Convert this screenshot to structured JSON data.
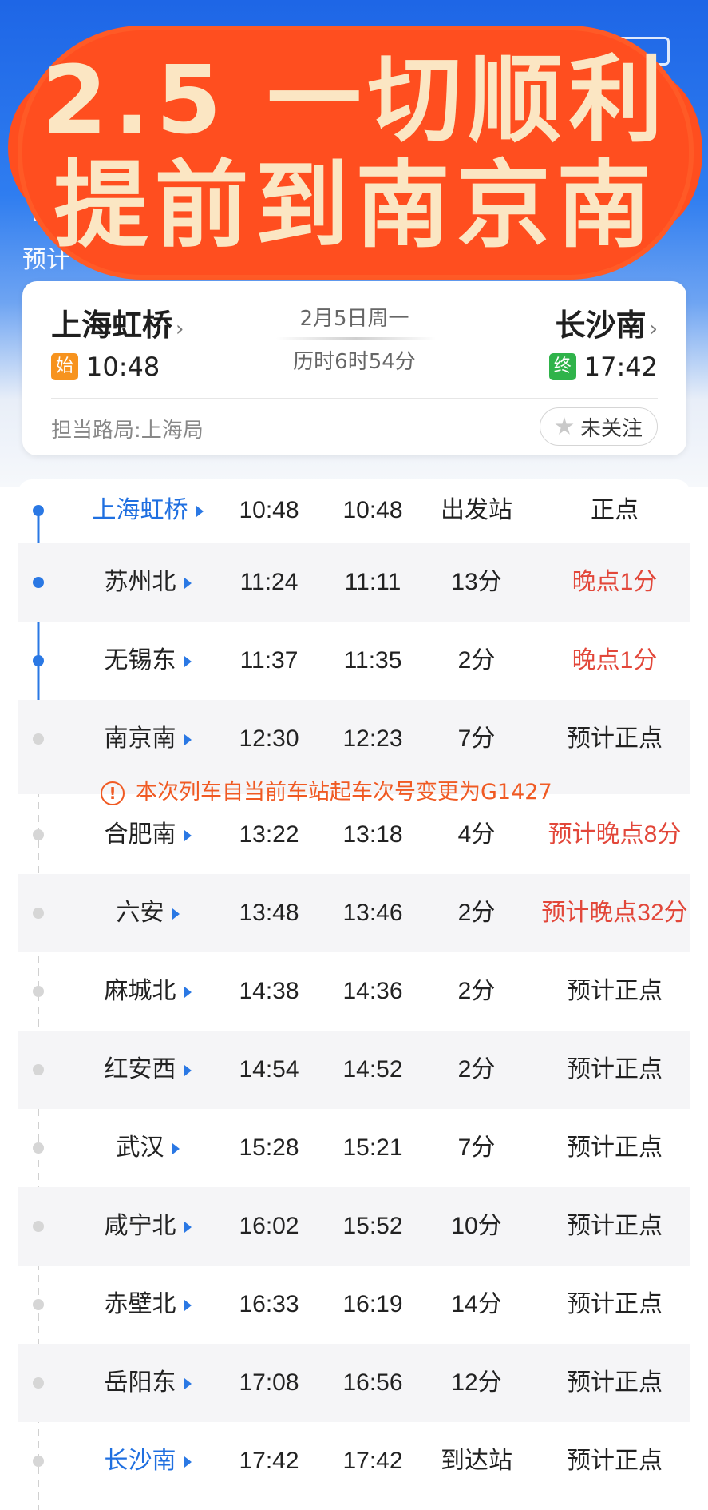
{
  "overlay": {
    "line1": "2.5 一切顺利",
    "line2": "提前到南京南"
  },
  "header": {
    "back_glyph": "〈",
    "train_partial": "T",
    "sub_partial": "预计",
    "refresh_glyph": "↻"
  },
  "route": {
    "from": {
      "name": "上海虹桥",
      "badge": "始",
      "time": "10:48"
    },
    "to": {
      "name": "长沙南",
      "badge": "终",
      "time": "17:42"
    },
    "date": "2月5日周一",
    "duration": "历时6时54分",
    "bureau": "担当路局:上海局",
    "follow_label": "未关注",
    "chevron": "›"
  },
  "notice": {
    "icon": "!",
    "text": "本次列车自当前车站起车次号变更为G1427"
  },
  "stations": [
    {
      "name": "上海虹桥",
      "arrive": "10:48",
      "depart": "10:48",
      "stop": "出发站",
      "status": "正点"
    },
    {
      "name": "苏州北",
      "arrive": "11:24",
      "depart": "11:11",
      "stop": "13分",
      "status": "晚点1分"
    },
    {
      "name": "无锡东",
      "arrive": "11:37",
      "depart": "11:35",
      "stop": "2分",
      "status": "晚点1分"
    },
    {
      "name": "南京南",
      "arrive": "12:30",
      "depart": "12:23",
      "stop": "7分",
      "status": "预计正点"
    },
    {
      "name": "合肥南",
      "arrive": "13:22",
      "depart": "13:18",
      "stop": "4分",
      "status": "预计晚点8分"
    },
    {
      "name": "六安",
      "arrive": "13:48",
      "depart": "13:46",
      "stop": "2分",
      "status": "预计晚点32分"
    },
    {
      "name": "麻城北",
      "arrive": "14:38",
      "depart": "14:36",
      "stop": "2分",
      "status": "预计正点"
    },
    {
      "name": "红安西",
      "arrive": "14:54",
      "depart": "14:52",
      "stop": "2分",
      "status": "预计正点"
    },
    {
      "name": "武汉",
      "arrive": "15:28",
      "depart": "15:21",
      "stop": "7分",
      "status": "预计正点"
    },
    {
      "name": "咸宁北",
      "arrive": "16:02",
      "depart": "15:52",
      "stop": "10分",
      "status": "预计正点"
    },
    {
      "name": "赤壁北",
      "arrive": "16:33",
      "depart": "16:19",
      "stop": "14分",
      "status": "预计正点"
    },
    {
      "name": "岳阳东",
      "arrive": "17:08",
      "depart": "16:56",
      "stop": "12分",
      "status": "预计正点"
    },
    {
      "name": "长沙南",
      "arrive": "17:42",
      "depart": "17:42",
      "stop": "到达站",
      "status": "预计正点"
    }
  ],
  "colors": {
    "primary_blue": "#1f6fe0",
    "late_red": "#e2473a",
    "overlay_orange": "#ff4e1f",
    "overlay_text": "#fbe6c3",
    "notice_orange": "#f05a23"
  }
}
